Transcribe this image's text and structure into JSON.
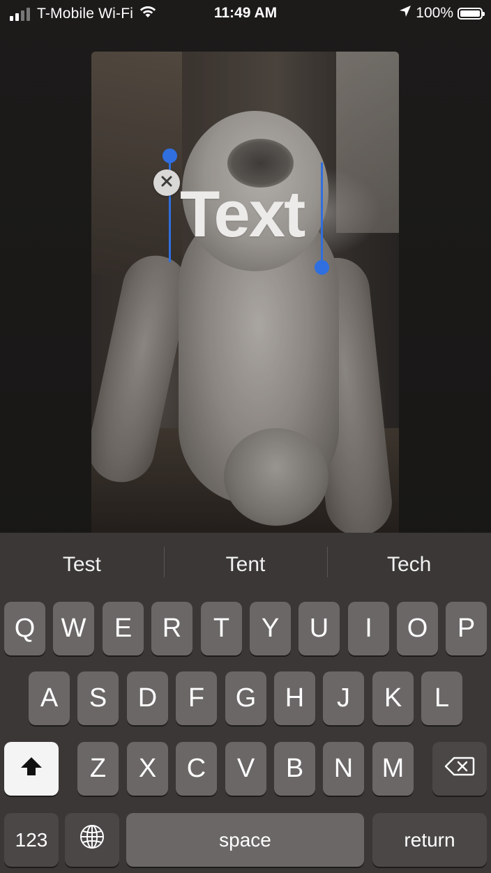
{
  "status_bar": {
    "carrier": "T-Mobile Wi-Fi",
    "time": "11:49 AM",
    "battery": "100%",
    "icons": [
      "cellular-signal-icon",
      "wifi-icon",
      "location-arrow-icon",
      "battery-icon"
    ]
  },
  "canvas": {
    "sticker_text": "Text",
    "delete_icon": "close-x-icon",
    "selection_color": "#2f6fe0"
  },
  "keyboard": {
    "suggestions": [
      "Test",
      "Tent",
      "Tech"
    ],
    "row1": [
      "Q",
      "W",
      "E",
      "R",
      "T",
      "Y",
      "U",
      "I",
      "O",
      "P"
    ],
    "row2": [
      "A",
      "S",
      "D",
      "F",
      "G",
      "H",
      "J",
      "K",
      "L"
    ],
    "row3": [
      "Z",
      "X",
      "C",
      "V",
      "B",
      "N",
      "M"
    ],
    "shift_icon": "shift-arrow-icon",
    "delete_icon": "backspace-icon",
    "numbers_label": "123",
    "globe_icon": "globe-icon",
    "space_label": "space",
    "return_label": "return"
  }
}
